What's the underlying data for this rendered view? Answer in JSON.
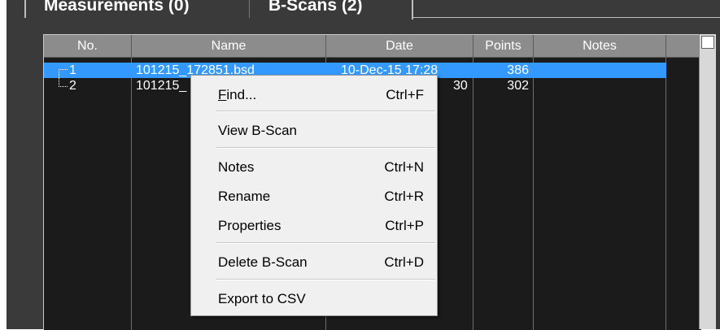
{
  "tabs": [
    {
      "label": "Measurements (0)"
    },
    {
      "label": "B-Scans (2)"
    }
  ],
  "columns": [
    "No.",
    "Name",
    "Date",
    "Points",
    "Notes"
  ],
  "rows": [
    {
      "no": "1",
      "name": "101215_172851.bsd",
      "date": "10-Dec-15 17:28",
      "points": "386",
      "notes": ""
    },
    {
      "no": "2",
      "name": "101215_",
      "date": "30",
      "points": "302",
      "notes": ""
    }
  ],
  "menu": {
    "find": {
      "label_pre": "",
      "label_u": "F",
      "label_post": "ind...",
      "shortcut": "Ctrl+F"
    },
    "view_bscan": {
      "label": "View B-Scan"
    },
    "notes": {
      "label": "Notes",
      "shortcut": "Ctrl+N"
    },
    "rename": {
      "label": "Rename",
      "shortcut": "Ctrl+R"
    },
    "properties": {
      "label": "Properties",
      "shortcut": "Ctrl+P"
    },
    "delete_bscan": {
      "label": "Delete B-Scan",
      "shortcut": "Ctrl+D"
    },
    "export_csv": {
      "label": "Export to CSV"
    }
  },
  "colors": {
    "background": "#3a3a3a",
    "grid": "#1b1b1b",
    "header": "#8c8c8c",
    "selection": "#3399ff",
    "menu": "#f0f0f0"
  }
}
